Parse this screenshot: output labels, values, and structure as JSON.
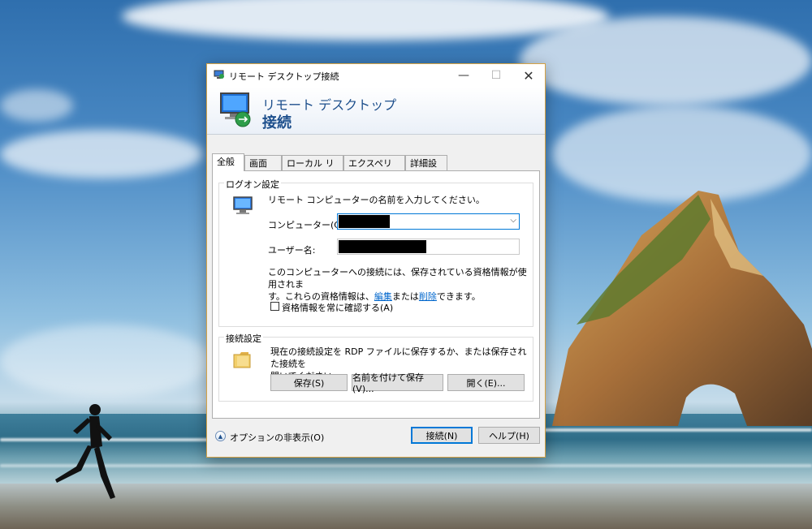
{
  "window": {
    "title": "リモート デスクトップ接続",
    "header_line1": "リモート デスクトップ",
    "header_line2": "接続"
  },
  "tabs": [
    {
      "label": "全般",
      "active": true
    },
    {
      "label": "画面",
      "active": false
    },
    {
      "label": "ローカル リソース",
      "active": false
    },
    {
      "label": "エクスペリエンス",
      "active": false
    },
    {
      "label": "詳細設定",
      "active": false
    }
  ],
  "logon": {
    "group_title": "ログオン設定",
    "instruction": "リモート コンピューターの名前を入力してください。",
    "computer_label": "コンピューター(C):",
    "computer_value": "",
    "username_label": "ユーザー名:",
    "username_value": "",
    "cred_text_1": "このコンピューターへの接続には、保存されている資格情報が使用されま",
    "cred_text_2_a": "す。これらの資格情報は、",
    "cred_link_edit": "編集",
    "cred_text_2_b": "または",
    "cred_link_delete": "削除",
    "cred_text_2_c": "できます。",
    "always_ask_label": "資格情報を常に確認する(A)",
    "always_ask_checked": false
  },
  "connection": {
    "group_title": "接続設定",
    "desc_1": "現在の接続設定を RDP ファイルに保存するか、または保存された接続を",
    "desc_2": "開いてください。",
    "save_label": "保存(S)",
    "save_as_label": "名前を付けて保存(V)...",
    "open_label": "開く(E)..."
  },
  "footer": {
    "options_label": "オプションの非表示(O)",
    "connect_label": "接続(N)",
    "help_label": "ヘルプ(H)"
  },
  "colors": {
    "accent": "#0078d7",
    "header_text": "#1d4f8c",
    "window_border": "#d6a244"
  }
}
